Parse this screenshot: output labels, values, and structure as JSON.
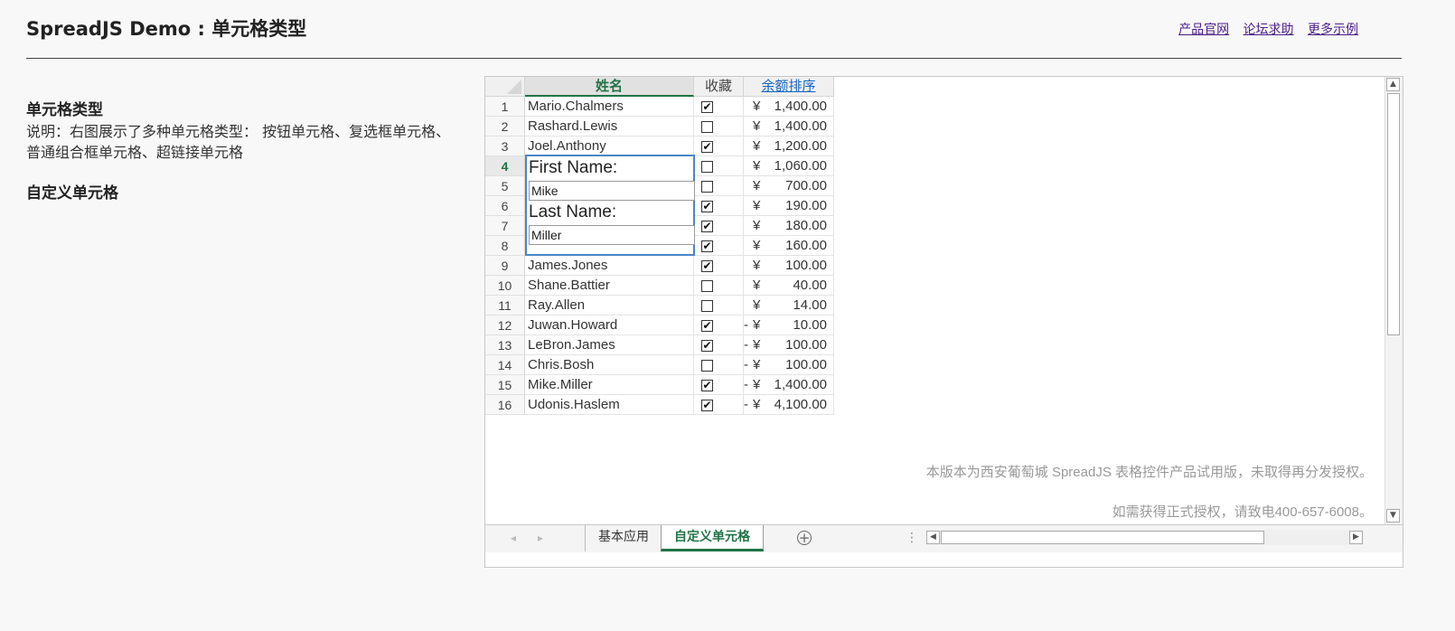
{
  "header": {
    "title": "SpreadJS Demo : 单元格类型",
    "links": [
      "产品官网",
      "论坛求助",
      "更多示例"
    ]
  },
  "sidebar": {
    "heading": "单元格类型",
    "description": "说明：右图展示了多种单元格类型： 按钮单元格、复选框单元格、普通组合框单元格、超链接单元格",
    "heading2": "自定义单元格"
  },
  "sheet": {
    "columns": [
      "姓名",
      "收藏",
      "余额排序"
    ],
    "active_row": 4,
    "rows": [
      {
        "n": "1",
        "name": "Mario.Chalmers",
        "fav": true,
        "neg": false,
        "amount": "1,400.00"
      },
      {
        "n": "2",
        "name": "Rashard.Lewis",
        "fav": false,
        "neg": false,
        "amount": "1,400.00"
      },
      {
        "n": "3",
        "name": "Joel.Anthony",
        "fav": true,
        "neg": false,
        "amount": "1,200.00"
      },
      {
        "n": "4",
        "name": "",
        "fav": false,
        "neg": false,
        "amount": "1,060.00"
      },
      {
        "n": "5",
        "name": "",
        "fav": false,
        "neg": false,
        "amount": "700.00"
      },
      {
        "n": "6",
        "name": "",
        "fav": true,
        "neg": false,
        "amount": "190.00"
      },
      {
        "n": "7",
        "name": "",
        "fav": true,
        "neg": false,
        "amount": "180.00"
      },
      {
        "n": "8",
        "name": "",
        "fav": true,
        "neg": false,
        "amount": "160.00"
      },
      {
        "n": "9",
        "name": "James.Jones",
        "fav": true,
        "neg": false,
        "amount": "100.00"
      },
      {
        "n": "10",
        "name": "Shane.Battier",
        "fav": false,
        "neg": false,
        "amount": "40.00"
      },
      {
        "n": "11",
        "name": "Ray.Allen",
        "fav": false,
        "neg": false,
        "amount": "14.00"
      },
      {
        "n": "12",
        "name": "Juwan.Howard",
        "fav": true,
        "neg": true,
        "amount": "10.00"
      },
      {
        "n": "13",
        "name": "LeBron.James",
        "fav": true,
        "neg": true,
        "amount": "100.00"
      },
      {
        "n": "14",
        "name": "Chris.Bosh",
        "fav": false,
        "neg": true,
        "amount": "100.00"
      },
      {
        "n": "15",
        "name": "Mike.Miller",
        "fav": true,
        "neg": true,
        "amount": "1,400.00"
      },
      {
        "n": "16",
        "name": "Udonis.Haslem",
        "fav": true,
        "neg": true,
        "amount": "4,100.00"
      }
    ],
    "currency_symbol": "¥",
    "negative_sign": "-",
    "checkmark": "✔"
  },
  "editor": {
    "first_label": "First Name:",
    "first_value": "Mike",
    "last_label": "Last Name:",
    "last_value": "Miller"
  },
  "watermark": {
    "line1": "本版本为西安葡萄城 SpreadJS 表格控件产品试用版，未取得再分发授权。",
    "line2": "如需获得正式授权，请致电400-657-6008。"
  },
  "tabs": {
    "items": [
      "基本应用",
      "自定义单元格"
    ],
    "active": 1,
    "add_symbol": "+",
    "more_symbol": "⋮",
    "nav_prev": "◂",
    "nav_next": "▸"
  },
  "colors": {
    "accent": "#217346",
    "link": "#1565c0",
    "editor_border": "#4a86c8"
  }
}
